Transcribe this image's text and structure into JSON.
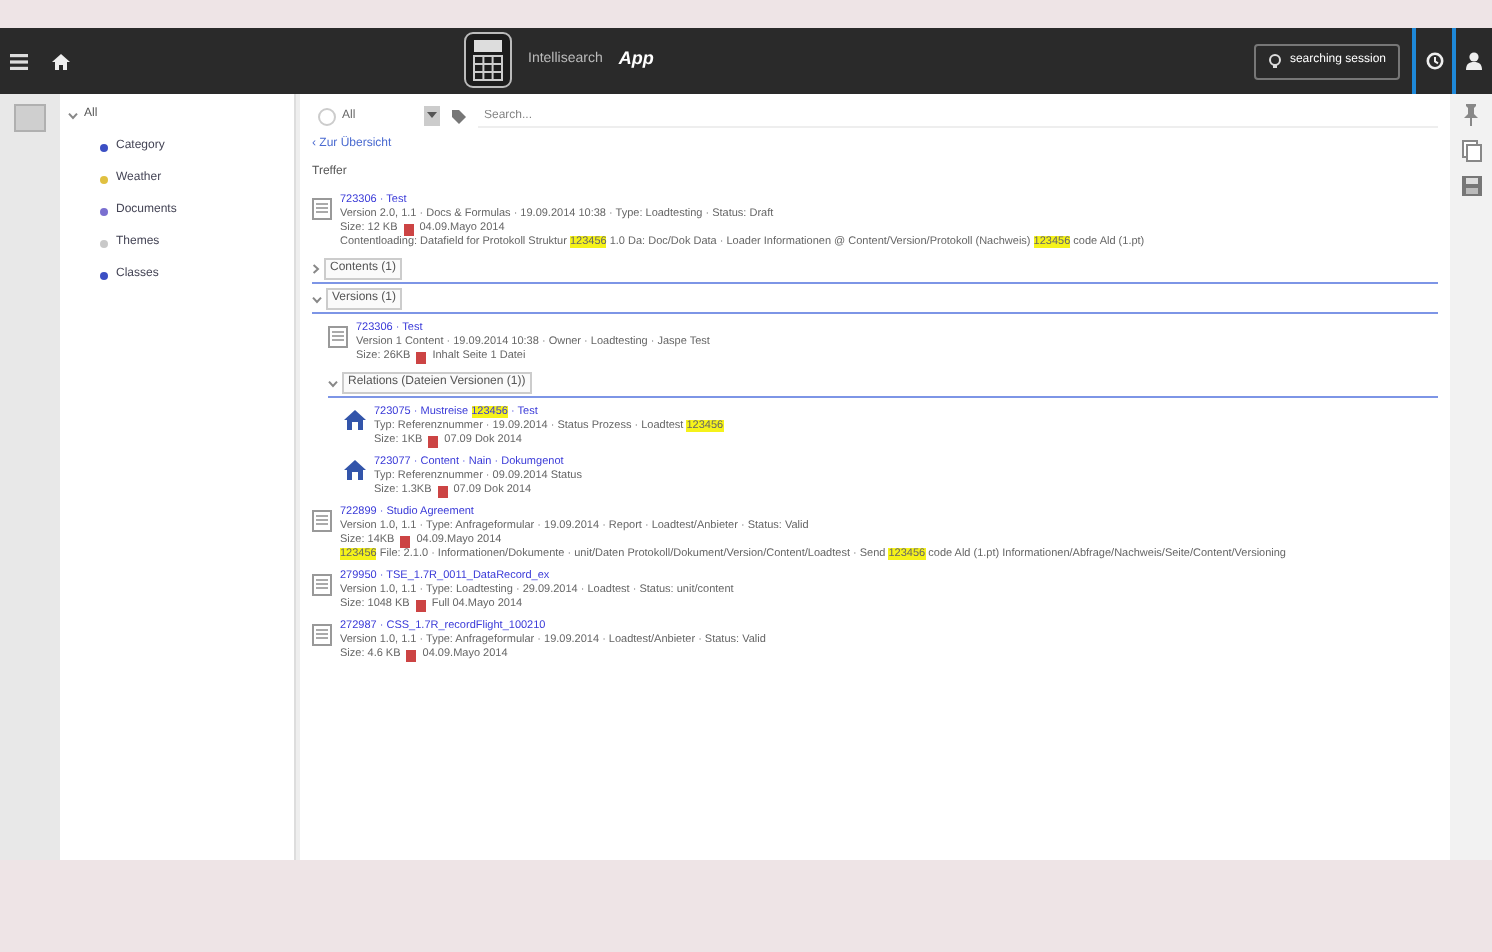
{
  "header": {
    "app_name": "Intellisearch",
    "app_suffix": "App",
    "session_button": "searching session"
  },
  "sidebar": {
    "root": {
      "label": "All",
      "expanded": true,
      "children": [
        {
          "label": "Category",
          "color": "#3b4fc4"
        },
        {
          "label": "Weather",
          "color": "#e0c040"
        },
        {
          "label": "Documents",
          "color": "#7a6fd0"
        },
        {
          "label": "Themes",
          "color": "#c8c8c8"
        },
        {
          "label": "Classes",
          "color": "#3b4fc4"
        }
      ]
    }
  },
  "toolbar": {
    "scope": "All",
    "search_placeholder": "Search..."
  },
  "back_link": "‹ Zur Übersicht",
  "results_heading": "Treffer",
  "results": [
    {
      "kind": "document",
      "title": "723306 · Test",
      "meta": "Version 2.0, 1.1 · Docs & Formulas · 19.09.2014 10:38 · Type: Loadtesting · Status: Draft",
      "size": "Size: 12 KB",
      "date": "04.09.Mayo 2014",
      "snippet": "Contentloading: Datafield for Protokoll Struktur **123456** 1.0 Da: Doc/Dok Data · Loader Informationen @ Content/Version/Protokoll (Nachweis) **123456** code Ald (1.pt)"
    },
    {
      "kind": "group",
      "label": "Contents (1)",
      "expanded": false
    },
    {
      "kind": "group",
      "label": "Versions (1)",
      "expanded": true,
      "children": [
        {
          "kind": "document",
          "title": "723306 · Test",
          "meta": "Version 1 Content · 19.09.2014 10:38 · Owner · Loadtesting · Jaspe Test",
          "size": "Size: 26KB",
          "date": "Inhalt Seite 1 Datei"
        },
        {
          "kind": "group",
          "label": "Relations (Dateien Versionen (1))",
          "expanded": true,
          "children": [
            {
              "kind": "record",
              "title": "723075 · Mustreise **123456** · Test",
              "meta": "Typ: Referenznummer · 19.09.2014 · Status Prozess · Loadtest **123456**",
              "size": "Size: 1KB",
              "date": "07.09 Dok 2014"
            },
            {
              "kind": "record",
              "title": "723077 · Content · Nain · Dokumgenot",
              "meta": "Typ: Referenznummer · 09.09.2014 Status",
              "size": "Size: 1.3KB",
              "date": "07.09 Dok 2014"
            }
          ]
        }
      ]
    },
    {
      "kind": "document",
      "title": "722899 · Studio Agreement",
      "meta": "Version 1.0, 1.1 · Type: Anfrageformular · 19.09.2014 · Report · Loadtest/Anbieter · Status: Valid",
      "size": "Size: 14KB",
      "date": "04.09.Mayo 2014",
      "snippet": "**123456** File: 2.1.0 · Informationen/Dokumente · unit/Daten Protokoll/Dokument/Version/Content/Loadtest · Send **123456** code Ald (1.pt) Informationen/Abfrage/Nachweis/Seite/Content/Versioning"
    },
    {
      "kind": "document",
      "title": "279950 · TSE_1.7R_0011_DataRecord_ex",
      "meta": "Version 1.0, 1.1 · Type: Loadtesting · 29.09.2014 · Loadtest · Status: unit/content",
      "size": "Size: 1048 KB",
      "date": "Full 04.Mayo 2014"
    },
    {
      "kind": "document",
      "title": "272987 · CSS_1.7R_recordFlight_100210",
      "meta": "Version 1.0, 1.1 · Type: Anfrageformular · 19.09.2014 · Loadtest/Anbieter · Status: Valid",
      "size": "Size: 4.6 KB",
      "date": "04.09.Mayo 2014"
    }
  ]
}
